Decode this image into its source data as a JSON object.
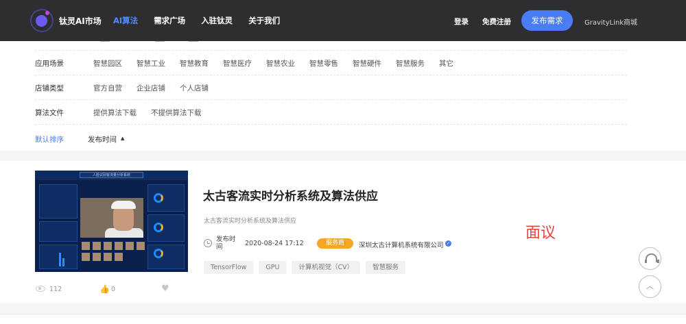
{
  "nav": {
    "brand": "钛灵AI市场",
    "links": [
      "AI算法",
      "需求广场",
      "入驻钛灵",
      "关于我们"
    ],
    "login": "登录",
    "register": "免费注册",
    "publish": "发布需求",
    "mall": "GravityLink商城",
    "accent": "#4a7cf3"
  },
  "filters": {
    "rows": [
      {
        "label": "应用场景",
        "options": [
          "智慧园区",
          "智慧工业",
          "智慧教育",
          "智慧医疗",
          "智慧农业",
          "智慧零售",
          "智慧硬件",
          "智慧服务",
          "其它"
        ]
      },
      {
        "label": "店铺类型",
        "options": [
          "官方自营",
          "企业店铺",
          "个人店铺"
        ]
      },
      {
        "label": "算法文件",
        "options": [
          "提供算法下载",
          "不提供算法下载"
        ]
      }
    ],
    "sort": {
      "default": "默认排序",
      "time": "发布时间",
      "arrow": "▲"
    }
  },
  "card": {
    "title": "太古客流实时分析系统及算法供应",
    "subtitle": "太古客流实时分析系统及算法供应",
    "publish_label": "发布时间",
    "publish_date": "2020-08-24 17:12",
    "badge": "服务商",
    "company": "深圳太古计算机系统有限公司",
    "verified_mark": "✓",
    "tags": [
      "TensorFlow",
      "GPU",
      "计算机视觉（CV）",
      "智慧服务"
    ],
    "price": "面议",
    "views": "112",
    "likes": "0",
    "thumb_title": "人脸识别客流量分析系统",
    "badge_color": "#f5a623",
    "price_color": "#e3463c"
  },
  "float": {
    "to_top": "︿"
  }
}
